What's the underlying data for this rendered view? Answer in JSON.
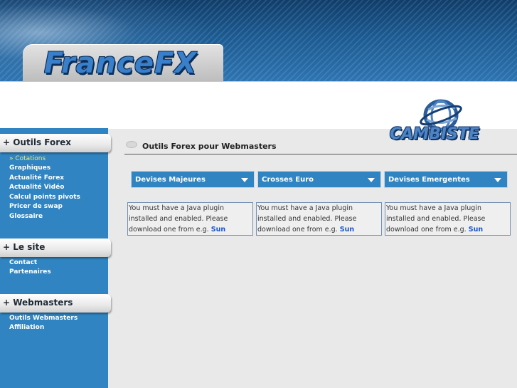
{
  "header": {
    "logo": "FranceFX"
  },
  "partner_logo": {
    "text": "CAMBISTE"
  },
  "sidebar": {
    "sections": [
      {
        "title": "+ Outils Forex",
        "items": [
          "» Cotations",
          "Graphiques",
          "Actualité Forex",
          "Actualité Vidéo",
          "Calcul points pivots",
          "Pricer de swap",
          "Glossaire"
        ]
      },
      {
        "title": "+ Le site",
        "items": [
          "Contact",
          "Partenaires"
        ]
      },
      {
        "title": "+ Webmasters",
        "items": [
          "Outils Webmasters",
          "Affiliation"
        ]
      }
    ]
  },
  "main": {
    "title": "Outils Forex pour Webmasters",
    "tabs": [
      {
        "label": "Devises Majeures"
      },
      {
        "label": "Crosses Euro"
      },
      {
        "label": "Devises Emergentes"
      }
    ],
    "java_message": "You must have a Java plugin installed and enabled. Please download one from e.g.",
    "java_link": "Sun"
  },
  "colors": {
    "sidebar_blue": "#2f84c1",
    "header_blue": "#1b5a91",
    "link_blue": "#1c55c7",
    "active_item": "#f2e77a"
  }
}
